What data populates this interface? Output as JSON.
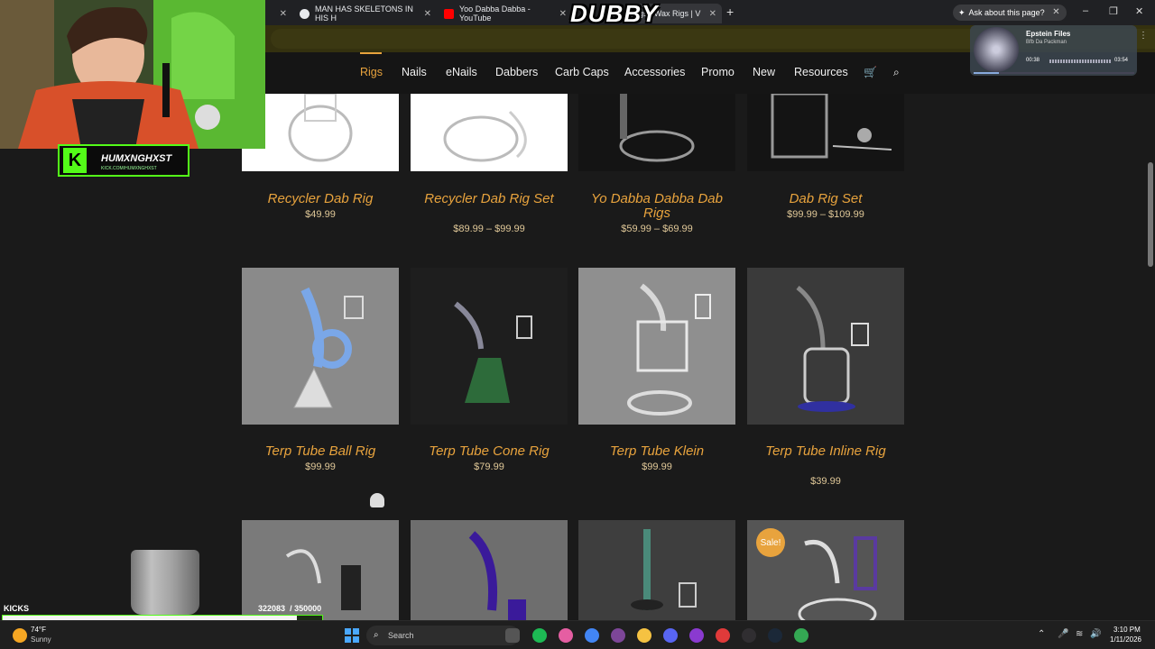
{
  "browser": {
    "tabs": [
      {
        "title": "MAN HAS SKELETONS IN HIS H",
        "favicon_color": "#e8eaed"
      },
      {
        "title": "Yoo Dabba Dabba - YouTube",
        "favicon_color": "#ff0000"
      },
      {
        "title": "gs | Wax Rigs | V",
        "favicon_color": "#888888"
      }
    ],
    "ask_label": "Ask about this page?",
    "new_tab_icon": "plus-icon"
  },
  "site": {
    "nav": [
      "Rigs",
      "Nails",
      "eNails",
      "Dabbers",
      "Carb Caps",
      "Accessories",
      "Promo",
      "New",
      "Resources"
    ],
    "active_nav": "Rigs",
    "accent_color": "#e8a33d",
    "row1": [
      {
        "title": "Recycler Dab Rig",
        "price": "$49.99",
        "bg": "#ffffff"
      },
      {
        "title": "Recycler Dab Rig Set",
        "price": "$89.99 – $99.99",
        "bg": "#ffffff"
      },
      {
        "title": "Yo Dabba Dabba Dab Rigs",
        "price": "$59.99 – $69.99",
        "bg": "#141414"
      },
      {
        "title": "Dab Rig Set",
        "price": "$99.99 – $109.99",
        "bg": "#141414"
      }
    ],
    "row2": [
      {
        "title": "Terp Tube Ball Rig",
        "price": "$99.99",
        "bg": "#8a8a8a",
        "accent": "#7aa7e8"
      },
      {
        "title": "Terp Tube Cone Rig",
        "price": "$79.99",
        "bg": "#1e1e1e",
        "accent": "#2d6b3a"
      },
      {
        "title": "Terp Tube Klein",
        "price": "$99.99",
        "bg": "#8f8f8f",
        "accent": "#d8d8d8"
      },
      {
        "title": "Terp Tube Inline Rig",
        "price": "$39.99",
        "bg": "#3a3a3a",
        "accent": "#3030a0"
      }
    ],
    "row3": [
      {
        "bg": "#7a7a7a",
        "accent": "#222222"
      },
      {
        "bg": "#6e6e6e",
        "accent": "#3a1a9a"
      },
      {
        "bg": "#3e3e3e",
        "accent": "#4a8a7a"
      },
      {
        "bg": "#555555",
        "accent": "#5a3aa0"
      }
    ],
    "sale_badge": "Sale!"
  },
  "stream": {
    "watermark": "DUBBY",
    "kick_name": "HUMXNGHXST",
    "kick_url": "KICK.COM/HUMXNGHXST",
    "goal_label": "KICKS",
    "goal_count": "322083",
    "goal_target": "/ 350000",
    "goal_fraction": 0.92
  },
  "music": {
    "title": "Epstein Files",
    "artist": "Bfb Da Packman",
    "elapsed": "00:38",
    "duration": "03:54",
    "progress": 0.16
  },
  "taskbar": {
    "temp": "74°F",
    "condition": "Sunny",
    "search_placeholder": "Search",
    "time": "3:10 PM",
    "date": "1/11/2026",
    "icons": [
      {
        "name": "spotify-icon",
        "color": "#1db954"
      },
      {
        "name": "itunes-icon",
        "color": "#e55ea2"
      },
      {
        "name": "chrome-icon",
        "color": "#4285f4"
      },
      {
        "name": "tor-icon",
        "color": "#7d4698"
      },
      {
        "name": "file-explorer-icon",
        "color": "#f5c242"
      },
      {
        "name": "discord-icon",
        "color": "#5865f2"
      },
      {
        "name": "app-icon",
        "color": "#8a3ad0"
      },
      {
        "name": "roblox-icon",
        "color": "#e03a3a"
      },
      {
        "name": "obs-icon",
        "color": "#302e31"
      },
      {
        "name": "steam-icon",
        "color": "#1b2838"
      },
      {
        "name": "chrome-alt-icon",
        "color": "#34a853"
      }
    ]
  }
}
